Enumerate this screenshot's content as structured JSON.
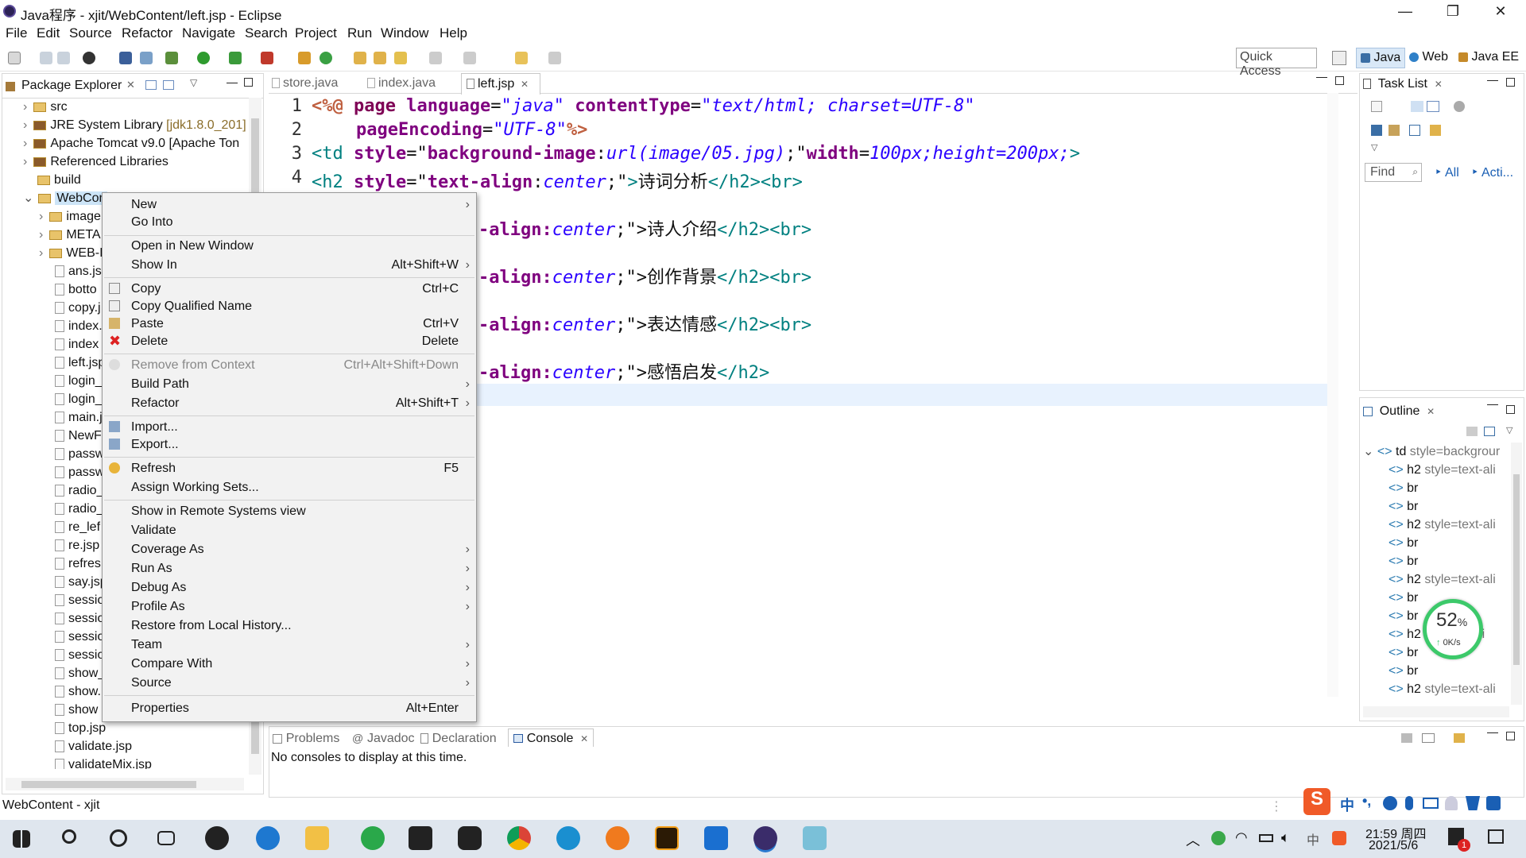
{
  "window": {
    "title": "Java程序 - xjit/WebContent/left.jsp - Eclipse"
  },
  "menu": [
    "File",
    "Edit",
    "Source",
    "Refactor",
    "Navigate",
    "Search",
    "Project",
    "Run",
    "Window",
    "Help"
  ],
  "toolbar": {
    "quick_access": "Quick Access",
    "perspectives": [
      "Java",
      "Web",
      "Java EE"
    ]
  },
  "package_explorer": {
    "title": "Package Explorer",
    "items": [
      {
        "label": "src",
        "extra": ""
      },
      {
        "label": "JRE System Library ",
        "extra": "[jdk1.8.0_201]"
      },
      {
        "label": "Apache Tomcat v9.0 [Apache Ton",
        "extra": ""
      },
      {
        "label": "Referenced Libraries",
        "extra": ""
      },
      {
        "label": "build",
        "extra": ""
      },
      {
        "label": "WebCon",
        "extra": ""
      },
      {
        "label": "image",
        "extra": ""
      },
      {
        "label": "META",
        "extra": ""
      },
      {
        "label": "WEB-I",
        "extra": ""
      },
      {
        "label": "ans.jsp",
        "extra": ""
      },
      {
        "label": "botto",
        "extra": ""
      },
      {
        "label": "copy.j",
        "extra": ""
      },
      {
        "label": "index.",
        "extra": ""
      },
      {
        "label": "index",
        "extra": ""
      },
      {
        "label": "left.jsp",
        "extra": ""
      },
      {
        "label": "login_",
        "extra": ""
      },
      {
        "label": "login_",
        "extra": ""
      },
      {
        "label": "main.j",
        "extra": ""
      },
      {
        "label": "NewF",
        "extra": ""
      },
      {
        "label": "passw",
        "extra": ""
      },
      {
        "label": "passw",
        "extra": ""
      },
      {
        "label": "radio_",
        "extra": ""
      },
      {
        "label": "radio_",
        "extra": ""
      },
      {
        "label": "re_lef",
        "extra": ""
      },
      {
        "label": "re.jsp",
        "extra": ""
      },
      {
        "label": "refres",
        "extra": ""
      },
      {
        "label": "say.jsp",
        "extra": ""
      },
      {
        "label": "sessio",
        "extra": ""
      },
      {
        "label": "sessio",
        "extra": ""
      },
      {
        "label": "sessio",
        "extra": ""
      },
      {
        "label": "sessio",
        "extra": ""
      },
      {
        "label": "show_",
        "extra": ""
      },
      {
        "label": "show.",
        "extra": ""
      },
      {
        "label": "show",
        "extra": ""
      },
      {
        "label": "top.jsp",
        "extra": ""
      },
      {
        "label": "validate.jsp",
        "extra": ""
      },
      {
        "label": "validateMix.jsp",
        "extra": ""
      }
    ]
  },
  "editor": {
    "tabs": [
      "store.java",
      "index.java",
      "left.jsp"
    ],
    "line_numbers": [
      "1",
      "2",
      "3",
      "4"
    ],
    "visible_fragments": {
      "row5": "-align:",
      "row5_val": "center",
      "row5_rest": ";\">",
      "row5_text": "诗人介绍",
      "row7_text": "创作背景",
      "row9_text": "表达情感",
      "row11_text": "感悟启发",
      "close_h2_br": "</h2><br>",
      "close_h2": "</h2>"
    }
  },
  "context_menu": {
    "items": [
      {
        "label": "New",
        "shortcut": "",
        "arrow": "›"
      },
      {
        "label": "Go Into",
        "shortcut": "",
        "arrow": ""
      },
      {
        "label": "Open in New Window",
        "shortcut": "",
        "arrow": ""
      },
      {
        "label": "Show In",
        "shortcut": "Alt+Shift+W",
        "arrow": "›"
      },
      {
        "label": "Copy",
        "shortcut": "Ctrl+C",
        "arrow": ""
      },
      {
        "label": "Copy Qualified Name",
        "shortcut": "",
        "arrow": ""
      },
      {
        "label": "Paste",
        "shortcut": "Ctrl+V",
        "arrow": ""
      },
      {
        "label": "Delete",
        "shortcut": "Delete",
        "arrow": ""
      },
      {
        "label": "Remove from Context",
        "shortcut": "Ctrl+Alt+Shift+Down",
        "arrow": ""
      },
      {
        "label": "Build Path",
        "shortcut": "",
        "arrow": "›"
      },
      {
        "label": "Refactor",
        "shortcut": "Alt+Shift+T",
        "arrow": "›"
      },
      {
        "label": "Import...",
        "shortcut": "",
        "arrow": ""
      },
      {
        "label": "Export...",
        "shortcut": "",
        "arrow": ""
      },
      {
        "label": "Refresh",
        "shortcut": "F5",
        "arrow": ""
      },
      {
        "label": "Assign Working Sets...",
        "shortcut": "",
        "arrow": ""
      },
      {
        "label": "Show in Remote Systems view",
        "shortcut": "",
        "arrow": ""
      },
      {
        "label": "Validate",
        "shortcut": "",
        "arrow": ""
      },
      {
        "label": "Coverage As",
        "shortcut": "",
        "arrow": "›"
      },
      {
        "label": "Run As",
        "shortcut": "",
        "arrow": "›"
      },
      {
        "label": "Debug As",
        "shortcut": "",
        "arrow": "›"
      },
      {
        "label": "Profile As",
        "shortcut": "",
        "arrow": "›"
      },
      {
        "label": "Restore from Local History...",
        "shortcut": "",
        "arrow": ""
      },
      {
        "label": "Team",
        "shortcut": "",
        "arrow": "›"
      },
      {
        "label": "Compare With",
        "shortcut": "",
        "arrow": "›"
      },
      {
        "label": "Source",
        "shortcut": "",
        "arrow": "›"
      },
      {
        "label": "Properties",
        "shortcut": "Alt+Enter",
        "arrow": ""
      }
    ]
  },
  "task_list": {
    "title": "Task List",
    "find_placeholder": "Find",
    "filter_all": "All",
    "filter_acti": "Acti..."
  },
  "outline": {
    "title": "Outline",
    "root": "td",
    "root_attr": "style=backgrour",
    "items": [
      {
        "tag": "h2",
        "attr": "style=text-ali"
      },
      {
        "tag": "br",
        "attr": ""
      },
      {
        "tag": "br",
        "attr": ""
      },
      {
        "tag": "h2",
        "attr": "style=text-ali"
      },
      {
        "tag": "br",
        "attr": ""
      },
      {
        "tag": "br",
        "attr": ""
      },
      {
        "tag": "h2",
        "attr": "style=text-ali"
      },
      {
        "tag": "br",
        "attr": ""
      },
      {
        "tag": "br",
        "attr": ""
      },
      {
        "tag": "h2",
        "attr": "t-ali"
      },
      {
        "tag": "br",
        "attr": ""
      },
      {
        "tag": "br",
        "attr": ""
      },
      {
        "tag": "h2",
        "attr": "style=text-ali"
      }
    ]
  },
  "net_widget": {
    "percent": "52",
    "percent_sign": "%",
    "speed": "0K/s"
  },
  "bottom_panel": {
    "tabs": [
      "Problems",
      "Javadoc",
      "Declaration",
      "Console"
    ],
    "message": "No consoles to display at this time."
  },
  "status": {
    "left": "WebContent - xjit"
  },
  "ime": {
    "items": [
      "中",
      "•,"
    ]
  },
  "taskbar": {
    "time": "21:59 周四",
    "date": "2021/5/6",
    "notif_count": "1"
  }
}
